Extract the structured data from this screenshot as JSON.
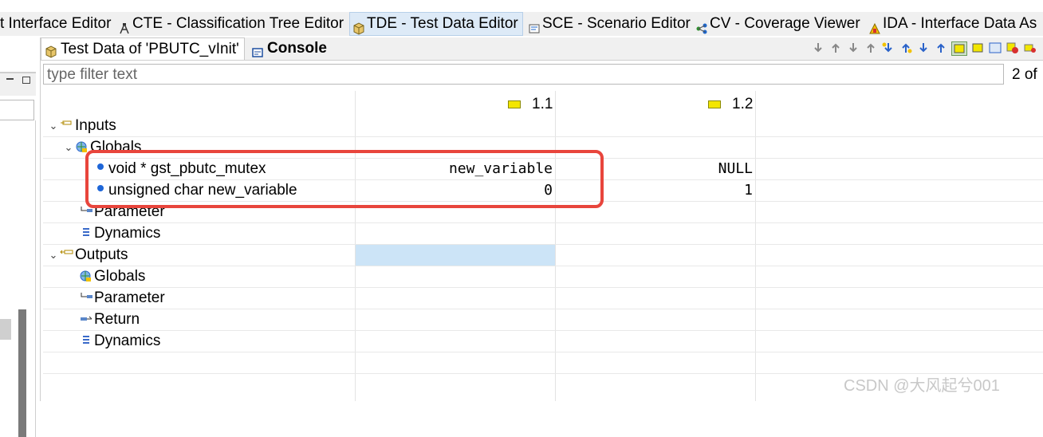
{
  "perspectives": [
    {
      "label": "t Interface Editor",
      "icon": "none",
      "active": false
    },
    {
      "label": "CTE - Classification Tree Editor",
      "icon": "cte-icon",
      "active": false
    },
    {
      "label": "TDE - Test Data Editor",
      "icon": "tde-icon",
      "active": true
    },
    {
      "label": "SCE - Scenario Editor",
      "icon": "sce-icon",
      "active": false
    },
    {
      "label": "CV - Coverage Viewer",
      "icon": "cv-icon",
      "active": false
    },
    {
      "label": "IDA - Interface Data As",
      "icon": "ida-icon",
      "active": false
    }
  ],
  "left_panel": {
    "min_icon": "minimize-icon",
    "max_icon": "maximize-icon"
  },
  "view_tabs": [
    {
      "label": "Test Data of 'PBUTC_vInit'",
      "active": true
    },
    {
      "label": "Console",
      "active": false
    }
  ],
  "filter": {
    "placeholder": "type filter text",
    "count": "2 of"
  },
  "columns": [
    {
      "label": "1.1"
    },
    {
      "label": "1.2"
    }
  ],
  "tree": [
    {
      "label": "Inputs",
      "level": 0,
      "expanded": true,
      "icon": "inputs-icon"
    },
    {
      "label": "Globals",
      "level": 1,
      "expanded": true,
      "icon": "globals-icon"
    },
    {
      "label": "void * gst_pbutc_mutex",
      "level": 2,
      "icon": "variable-dot-icon",
      "values": [
        "new_variable",
        "NULL"
      ]
    },
    {
      "label": "unsigned char new_variable",
      "level": 2,
      "icon": "variable-dot-icon",
      "values": [
        "0",
        "1"
      ]
    },
    {
      "label": "Parameter",
      "level": 1,
      "icon": "parameter-icon"
    },
    {
      "label": "Dynamics",
      "level": 1,
      "icon": "dynamics-icon"
    },
    {
      "label": "Outputs",
      "level": 0,
      "expanded": true,
      "icon": "outputs-icon"
    },
    {
      "label": "Globals",
      "level": 1,
      "icon": "globals-icon"
    },
    {
      "label": "Parameter",
      "level": 1,
      "icon": "parameter-icon"
    },
    {
      "label": "Return",
      "level": 1,
      "icon": "return-icon"
    },
    {
      "label": "Dynamics",
      "level": 1,
      "icon": "dynamics-icon"
    }
  ],
  "watermark": "CSDN @大风起兮001",
  "colors": {
    "highlight_box": "#e8453c",
    "selected_cell": "#cce4f7",
    "tab_active": "#ddeaf7"
  }
}
